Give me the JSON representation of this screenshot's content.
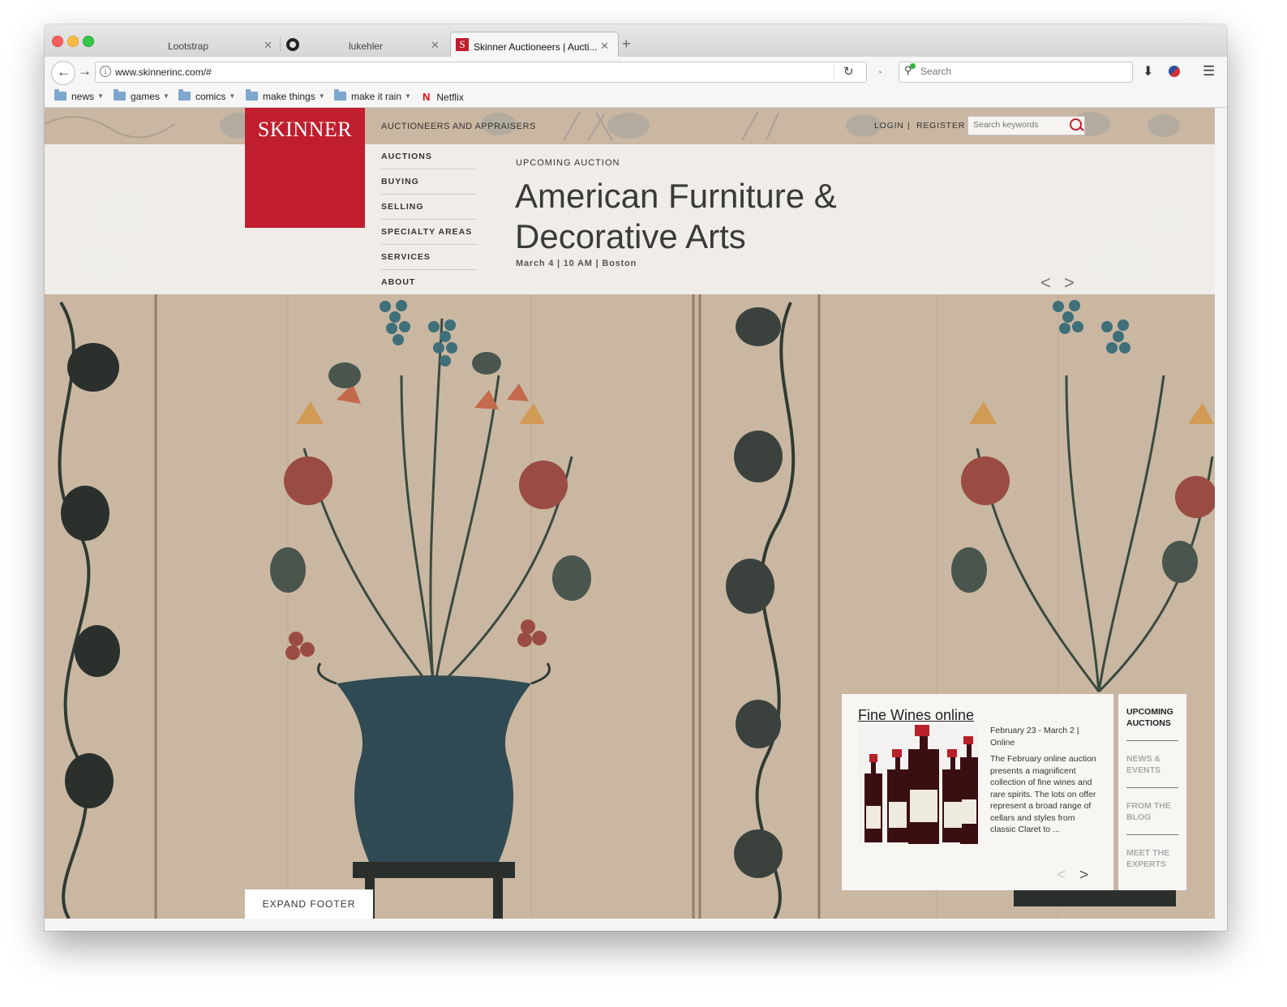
{
  "browser": {
    "tabs": [
      {
        "title": "Lootstrap",
        "active": false,
        "icon": "page-icon"
      },
      {
        "title": "lukehler",
        "active": false,
        "icon": "github-icon"
      },
      {
        "title": "Skinner Auctioneers | Aucti...",
        "active": true,
        "icon": "skinner-favicon",
        "favicon_text": "S"
      }
    ],
    "url": "www.skinnerinc.com/#",
    "search_placeholder": "Search",
    "bookmarks": [
      {
        "label": "news",
        "icon": "folder-icon",
        "dropdown": true
      },
      {
        "label": "games",
        "icon": "folder-icon",
        "dropdown": true
      },
      {
        "label": "comics",
        "icon": "folder-icon",
        "dropdown": true
      },
      {
        "label": "make things",
        "icon": "folder-icon",
        "dropdown": true
      },
      {
        "label": "make it rain",
        "icon": "folder-icon",
        "dropdown": true
      },
      {
        "label": "Netflix",
        "icon": "netflix-icon",
        "icon_text": "N",
        "dropdown": false
      }
    ]
  },
  "site": {
    "logo": "SKINNER",
    "tagline": "AUCTIONEERS AND APPRAISERS",
    "login": "LOGIN",
    "separator": "|",
    "register": "REGISTER",
    "search_placeholder": "Search keywords",
    "menu": [
      "AUCTIONS",
      "BUYING",
      "SELLING",
      "SPECIALTY AREAS",
      "SERVICES",
      "ABOUT"
    ],
    "brand_color": "#c01e2e"
  },
  "hero": {
    "eyebrow": "UPCOMING AUCTION",
    "title": "American Furniture & Decorative Arts",
    "meta": "March 4 | 10 AM | Boston",
    "prev": "<",
    "next": ">"
  },
  "feature": {
    "title": "Fine Wines online",
    "date": "February 23 - March 2 | Online",
    "description": "The February online auction presents a magnificent collection of fine wines and rare spirits. The lots on offer represent a broad range of cellars and styles from classic Claret to ...",
    "prev": "<",
    "next": ">"
  },
  "side_tabs": [
    "UPCOMING AUCTIONS",
    "NEWS & EVENTS",
    "FROM THE BLOG",
    "MEET THE EXPERTS"
  ],
  "footer_button": "EXPAND FOOTER"
}
